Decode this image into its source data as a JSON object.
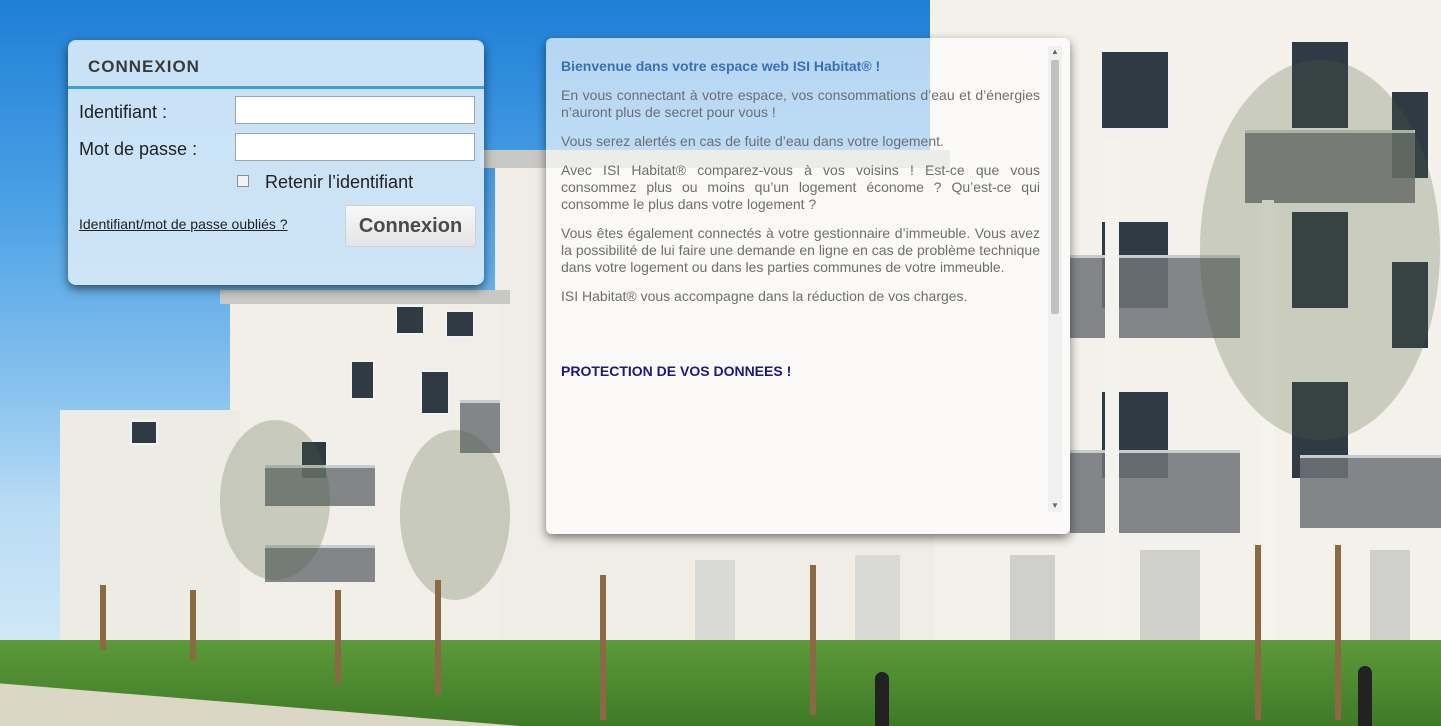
{
  "login": {
    "title": "CONNEXION",
    "username_label": "Identifiant :",
    "username_value": "",
    "password_label": "Mot de passe :",
    "password_value": "",
    "remember_label": "Retenir l’identifiant",
    "remember_checked": false,
    "forgot_link": "Identifiant/mot de passe oubliés ?",
    "submit_label": "Connexion"
  },
  "info": {
    "welcome_heading": "Bienvenue dans votre espace web ISI Habitat® !",
    "paragraphs": [
      "En vous connectant à votre espace, vos consommations d’eau et d’énergies n’auront plus de secret pour vous !",
      "Vous serez alertés en cas de fuite d’eau dans votre logement.",
      "Avec ISI Habitat® comparez-vous à vos voisins ! Est-ce que vous consommez plus ou moins qu’un logement économe ? Qu’est-ce qui consomme le plus dans votre logement ?",
      "Vous êtes également connectés à votre gestionnaire d’immeuble. Vous avez la possibilité de lui faire une demande en ligne en cas de problème technique dans votre logement ou dans les parties communes de votre immeuble.",
      "ISI Habitat® vous accompagne dans la réduction de vos charges."
    ],
    "protection_heading": "PROTECTION DE VOS DONNEES !"
  },
  "icons": {
    "scroll_up": "triangle-up-icon",
    "scroll_down": "triangle-down-icon"
  },
  "colors": {
    "accent_rule": "#3aa0d8",
    "welcome_heading": "#3b6fb5",
    "protection_heading": "#1a1a7a"
  }
}
